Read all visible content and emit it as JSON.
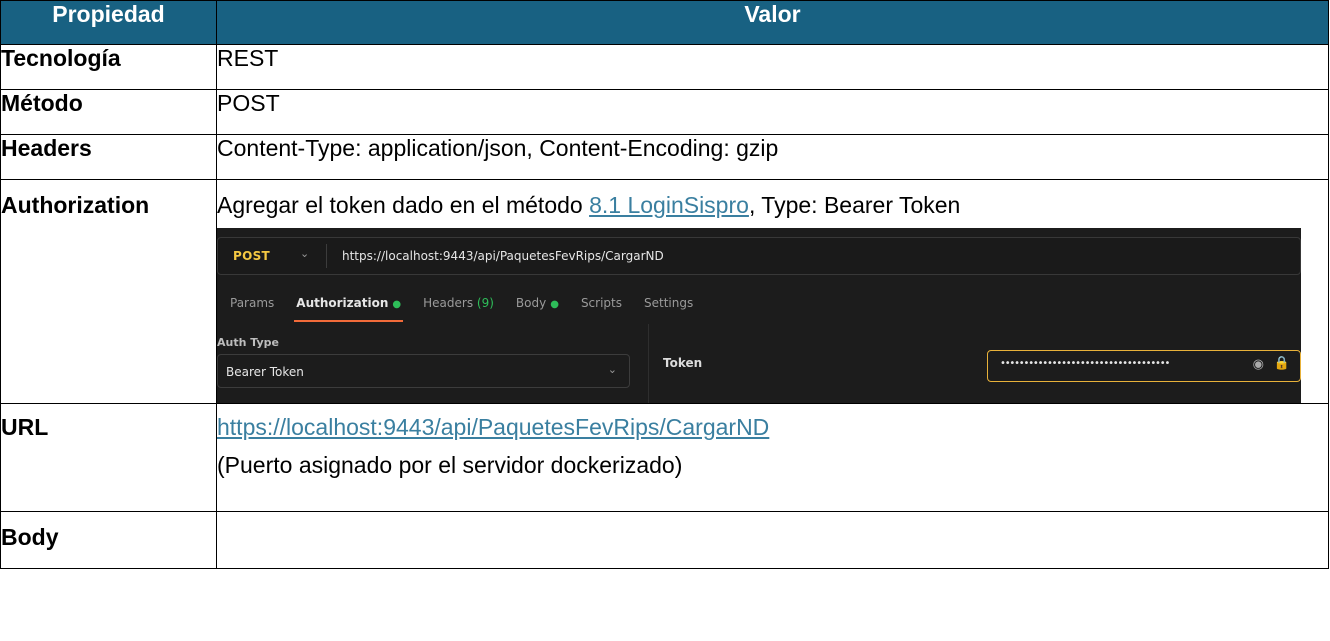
{
  "headers": {
    "property": "Propiedad",
    "value": "Valor"
  },
  "rows": {
    "technology": {
      "key": "Tecnología",
      "value": "REST"
    },
    "method": {
      "key": "Método",
      "value": "POST"
    },
    "headers": {
      "key": "Headers",
      "value": "Content-Type: application/json, Content-Encoding: gzip"
    },
    "authorization": {
      "key": "Authorization",
      "text_before": "Agregar el token dado en el método ",
      "link": "8.1 LoginSispro",
      "text_after": ", Type: Bearer Token"
    },
    "url": {
      "key": "URL",
      "link": "https://localhost:9443/api/PaquetesFevRips/CargarND",
      "note": "(Puerto asignado por el servidor dockerizado)"
    },
    "body": {
      "key": "Body",
      "value": ""
    }
  },
  "screenshot": {
    "method": "POST",
    "url": "https://localhost:9443/api/PaquetesFevRips/CargarND",
    "tabs": {
      "params": "Params",
      "authorization": "Authorization",
      "headers": "Headers",
      "headers_count": "(9)",
      "body": "Body",
      "scripts": "Scripts",
      "settings": "Settings"
    },
    "auth_type_label": "Auth Type",
    "auth_type_value": "Bearer Token",
    "token_label": "Token",
    "token_value": "••••••••••••••••••••••••••••••••••••",
    "colors": {
      "method": "#f5c842",
      "active_dot": "#2ebd59",
      "tab_underline": "#f26b3a",
      "token_border": "#e8b23a"
    }
  },
  "colors": {
    "header_bg": "#186182",
    "link": "#3a7fa0"
  }
}
